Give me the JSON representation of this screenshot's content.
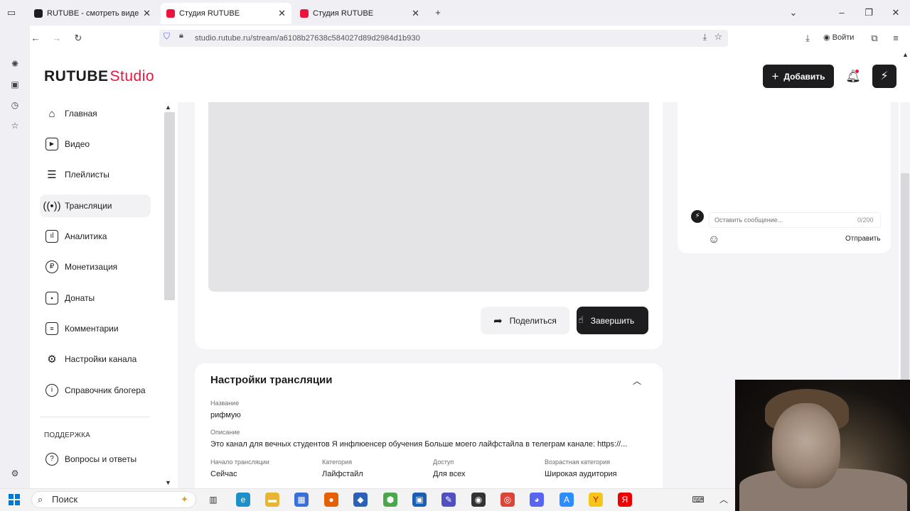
{
  "browser": {
    "tabs": [
      {
        "title": "RUTUBE - смотреть видео онл",
        "active": false
      },
      {
        "title": "Студия RUTUBE",
        "active": true
      },
      {
        "title": "Студия RUTUBE",
        "active": false
      }
    ],
    "url": "studio.rutube.ru/stream/a6108b27638c584027d89d2984d1b930",
    "login_label": "Войти"
  },
  "header": {
    "logo_main": "RUTUBE",
    "logo_studio": "Studio",
    "add_label": "Добавить"
  },
  "sidebar": {
    "items": [
      {
        "label": "Главная",
        "icon": "home-icon"
      },
      {
        "label": "Видео",
        "icon": "video-icon"
      },
      {
        "label": "Плейлисты",
        "icon": "playlist-icon"
      },
      {
        "label": "Трансляции",
        "icon": "broadcast-icon",
        "active": true
      },
      {
        "label": "Аналитика",
        "icon": "analytics-icon"
      },
      {
        "label": "Монетизация",
        "icon": "ruble-icon"
      },
      {
        "label": "Донаты",
        "icon": "wallet-icon"
      },
      {
        "label": "Комментарии",
        "icon": "comment-icon"
      },
      {
        "label": "Настройки канала",
        "icon": "gear-icon"
      },
      {
        "label": "Справочник блогера",
        "icon": "info-icon"
      }
    ],
    "support_header": "ПОДДЕРЖКА",
    "support_items": [
      {
        "label": "Вопросы и ответы",
        "icon": "question-icon"
      }
    ]
  },
  "stream": {
    "share_label": "Поделиться",
    "finish_label": "Завершить"
  },
  "chat": {
    "placeholder": "Оставить сообщение...",
    "counter": "0/200",
    "send_label": "Отправить"
  },
  "settings": {
    "title": "Настройки трансляции",
    "name_label": "Название",
    "name_value": "рифмую",
    "description_label": "Описание",
    "description_value": "Это канал для вечных студентов Я инфлюенсер обучения Больше моего лайфстайла в телеграм канале: https://...",
    "fields": [
      {
        "label": "Начало трансляции",
        "value": "Сейчас"
      },
      {
        "label": "Категория",
        "value": "Лайфстайл"
      },
      {
        "label": "Доступ",
        "value": "Для всех"
      },
      {
        "label": "Возрастная категория",
        "value": "Широкая аудитория"
      }
    ]
  },
  "taskbar": {
    "search_label": "Поиск"
  },
  "colors": {
    "brand": "#ed143b",
    "dark": "#1d1d1f"
  }
}
